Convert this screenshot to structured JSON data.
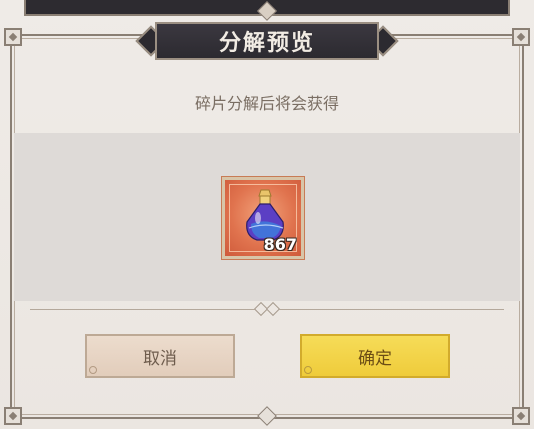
{
  "dialog": {
    "title": "分解预览",
    "subtitle": "碎片分解后将会获得"
  },
  "reward": {
    "icon": "purple-potion-icon",
    "count": "867"
  },
  "buttons": {
    "cancel_label": "取消",
    "confirm_label": "确定"
  },
  "colors": {
    "confirm_button": "#efcc3b",
    "cancel_button": "#e2cdbb",
    "item_background": "#e0734e",
    "title_plate": "#2c2a30"
  }
}
